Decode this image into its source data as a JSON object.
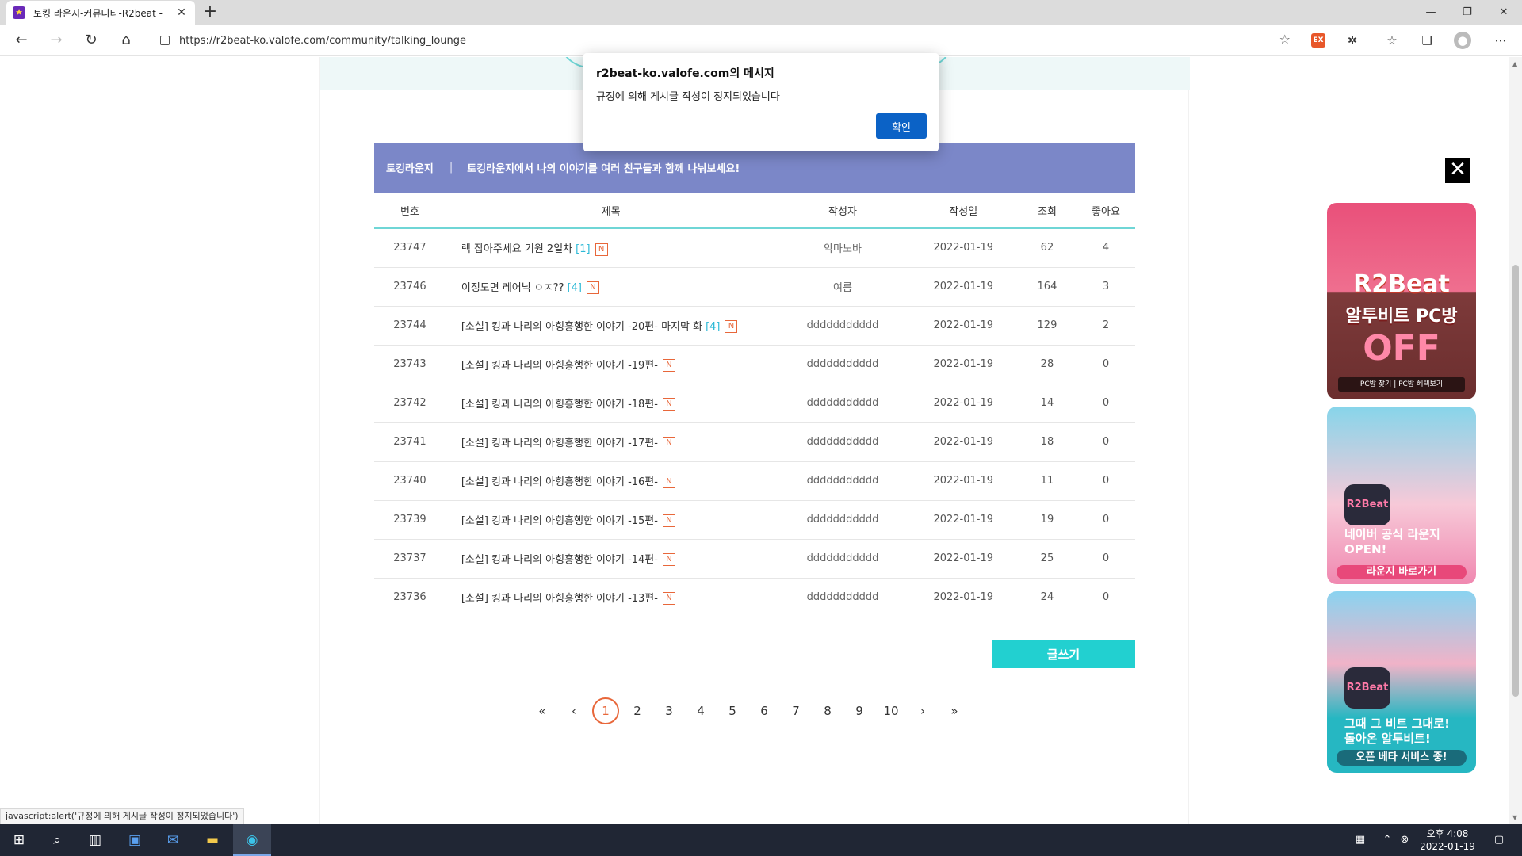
{
  "browser": {
    "tab_title": "토킹 라운지-커뮤니티-R2beat - ",
    "url": "https://r2beat-ko.valofe.com/community/talking_lounge",
    "status_text": "javascript:alert('규정에 의해 게시글 작성이 정지되었습니다')"
  },
  "board": {
    "name": "토킹라운지",
    "separator": "|",
    "description": "토킹라운지에서 나의 이야기를 여러 친구들과 함께 나눠보세요!",
    "columns": [
      "번호",
      "제목",
      "작성자",
      "작성일",
      "조회",
      "좋아요"
    ],
    "new_badge": "N",
    "rows": [
      {
        "no": "23747",
        "title": "렉 잡아주세요 기원 2일차",
        "comments": "[1]",
        "author": "악마노바",
        "date": "2022-01-19",
        "views": "62",
        "likes": "4"
      },
      {
        "no": "23746",
        "title": "이정도면 레어닉 ㅇㅈ??",
        "comments": "[4]",
        "author": "여름",
        "date": "2022-01-19",
        "views": "164",
        "likes": "3"
      },
      {
        "no": "23744",
        "title": "[소설] 킹과 나리의 아힝흥행한 이야기 -20편- 마지막 화",
        "comments": "[4]",
        "author": "ddddddddddd",
        "date": "2022-01-19",
        "views": "129",
        "likes": "2"
      },
      {
        "no": "23743",
        "title": "[소설] 킹과 나리의 아힝흥행한 이야기 -19편-",
        "comments": "",
        "author": "ddddddddddd",
        "date": "2022-01-19",
        "views": "28",
        "likes": "0"
      },
      {
        "no": "23742",
        "title": "[소설] 킹과 나리의 아힝흥행한 이야기 -18편-",
        "comments": "",
        "author": "ddddddddddd",
        "date": "2022-01-19",
        "views": "14",
        "likes": "0"
      },
      {
        "no": "23741",
        "title": "[소설] 킹과 나리의 아힝흥행한 이야기 -17편-",
        "comments": "",
        "author": "ddddddddddd",
        "date": "2022-01-19",
        "views": "18",
        "likes": "0"
      },
      {
        "no": "23740",
        "title": "[소설] 킹과 나리의 아힝흥행한 이야기 -16편-",
        "comments": "",
        "author": "ddddddddddd",
        "date": "2022-01-19",
        "views": "11",
        "likes": "0"
      },
      {
        "no": "23739",
        "title": "[소설] 킹과 나리의 아힝흥행한 이야기 -15편-",
        "comments": "",
        "author": "ddddddddddd",
        "date": "2022-01-19",
        "views": "19",
        "likes": "0"
      },
      {
        "no": "23737",
        "title": "[소설] 킹과 나리의 아힝흥행한 이야기 -14편-",
        "comments": "",
        "author": "ddddddddddd",
        "date": "2022-01-19",
        "views": "25",
        "likes": "0"
      },
      {
        "no": "23736",
        "title": "[소설] 킹과 나리의 아힝흥행한 이야기 -13편-",
        "comments": "",
        "author": "ddddddddddd",
        "date": "2022-01-19",
        "views": "24",
        "likes": "0"
      }
    ],
    "write_button": "글쓰기"
  },
  "pagination": {
    "first": "«",
    "prev": "‹",
    "pages": [
      "1",
      "2",
      "3",
      "4",
      "5",
      "6",
      "7",
      "8",
      "9",
      "10"
    ],
    "current": "1",
    "next": "›",
    "last": "»"
  },
  "banners": {
    "close": "✕",
    "b1": {
      "logo": "R2Beat",
      "subtitle": "알투비트 PC방",
      "off": "OFF",
      "links": "PC방 찾기 | PC방 혜택보기"
    },
    "b2": {
      "icon": "R2Beat",
      "text_line1": "네이버 공식 라운지",
      "text_line2": "OPEN!",
      "button": "라운지 바로가기"
    },
    "b3": {
      "icon": "R2Beat",
      "text_line1": "그때 그 비트 그대로!",
      "text_line2": "돌아온 알투비트!",
      "button": "오픈 베타 서비스 중!"
    }
  },
  "dialog": {
    "title": "r2beat-ko.valofe.com의 메시지",
    "message": "규정에 의해 게시글 작성이 정지되었습니다",
    "ok": "확인"
  },
  "taskbar": {
    "time": "오후 4:08",
    "date": "2022-01-19"
  },
  "colors": {
    "board_header_bg": "#7b87c8",
    "accent_teal": "#22d0d0",
    "new_badge": "#e8673a",
    "dialog_button": "#0b62c6"
  }
}
